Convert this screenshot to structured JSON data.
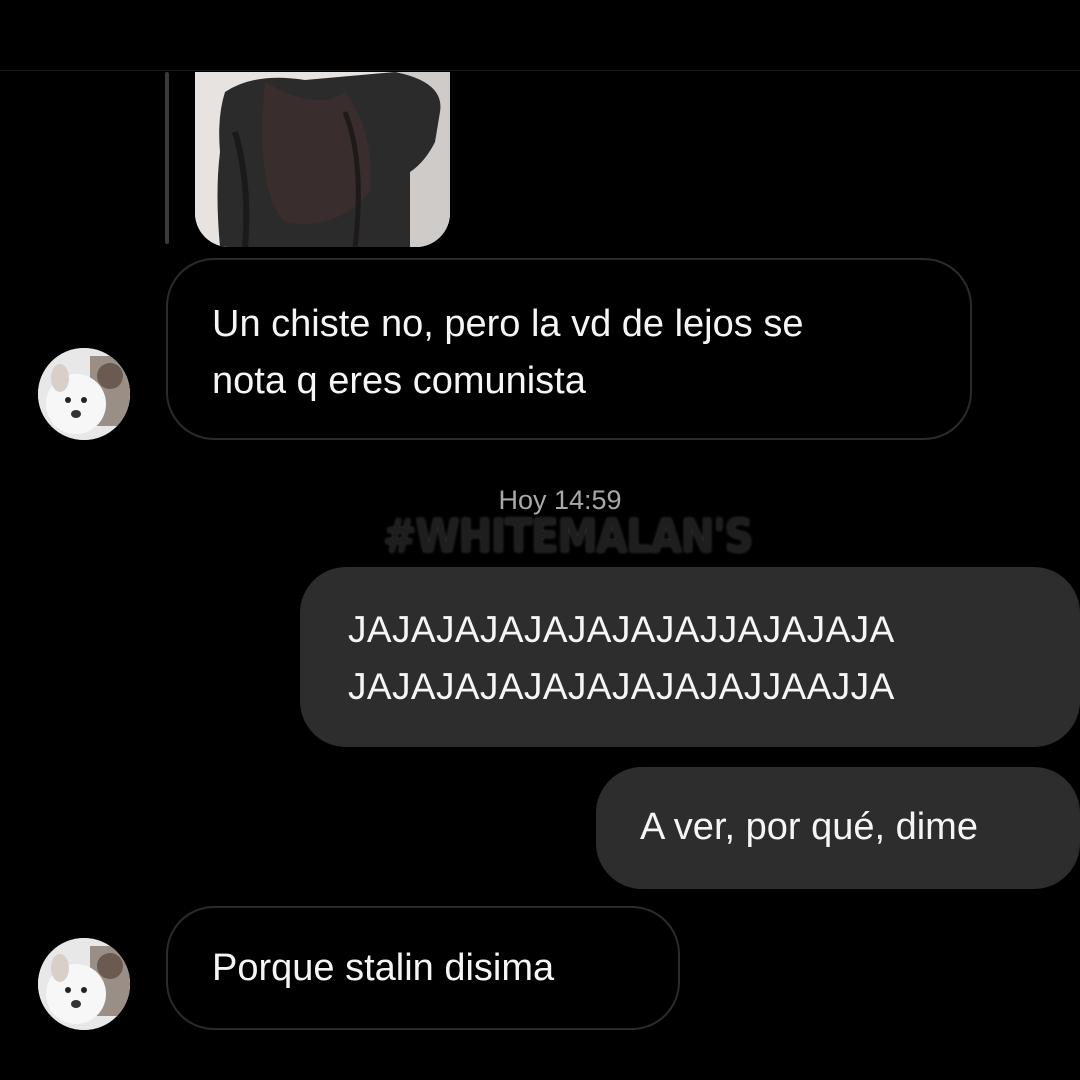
{
  "shared_image": {
    "icon": "image-thumbnail"
  },
  "messages": [
    {
      "sender": "other",
      "text_lines": [
        "Un chiste no, pero la vd de lejos se",
        "nota q eres comunista"
      ]
    },
    {
      "sender": "self",
      "text_lines": [
        "JAJAJAJAJAJAJAJAJJAJAJAJA",
        "JAJAJAJAJAJAJAJAJAJJAAJJA"
      ]
    },
    {
      "sender": "self",
      "text_lines": [
        "A ver, por qué, dime"
      ]
    },
    {
      "sender": "other",
      "text_lines": [
        "Porque stalin disima"
      ]
    }
  ],
  "timestamp": "Hoy 14:59",
  "watermark": "#WHITEMALAN'S",
  "colors": {
    "background": "#000000",
    "outgoing_bubble": "#2d2d2d",
    "incoming_bubble_border": "#2b2b2b",
    "text": "#f5f5f5",
    "timestamp": "#a8a8a8"
  }
}
